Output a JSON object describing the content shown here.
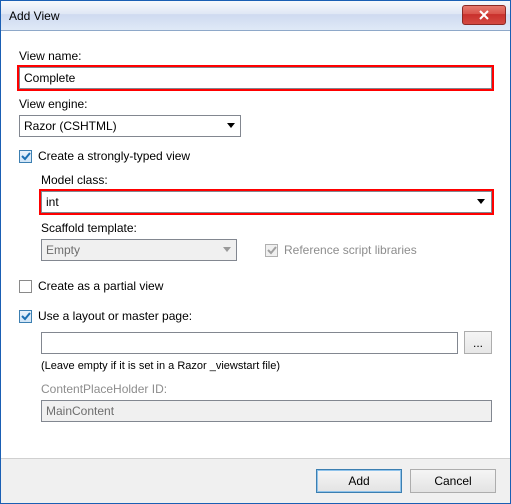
{
  "window": {
    "title": "Add View"
  },
  "labels": {
    "view_name": "View name:",
    "view_engine": "View engine:",
    "model_class": "Model class:",
    "scaffold_template": "Scaffold template:",
    "content_placeholder": "ContentPlaceHolder ID:",
    "layout_hint": "(Leave empty if it is set in a Razor _viewstart file)"
  },
  "values": {
    "view_name": "Complete",
    "view_engine": "Razor (CSHTML)",
    "model_class": "int",
    "scaffold_template": "Empty",
    "layout_path": "",
    "content_placeholder": "MainContent"
  },
  "checkboxes": {
    "strongly_typed": {
      "label": "Create a strongly-typed view",
      "checked": true
    },
    "reference_libs": {
      "label": "Reference script libraries",
      "checked": true,
      "disabled": true
    },
    "partial_view": {
      "label": "Create as a partial view",
      "checked": false
    },
    "use_layout": {
      "label": "Use a layout or master page:",
      "checked": true
    }
  },
  "buttons": {
    "browse": "...",
    "add": "Add",
    "cancel": "Cancel"
  },
  "colors": {
    "highlight": "#ff0000",
    "accent": "#3c7fb1"
  }
}
